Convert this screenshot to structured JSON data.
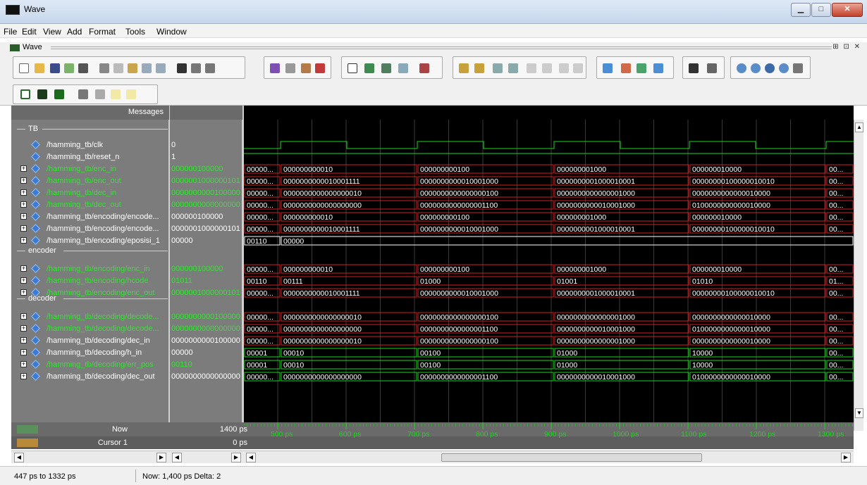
{
  "window": {
    "title": "Wave"
  },
  "menu": [
    "File",
    "Edit",
    "View",
    "Add",
    "Format",
    "Tools",
    "Window"
  ],
  "wave_header": {
    "label": "Wave"
  },
  "messages_header": "Messages",
  "groups": {
    "tb": "TB",
    "encoder": "encoder",
    "decoder": "decoder"
  },
  "signals": [
    {
      "name": "/hamming_tb/clk",
      "value": "0",
      "expandable": false,
      "highlight": false
    },
    {
      "name": "/hamming_tb/reset_n",
      "value": "1",
      "expandable": false,
      "highlight": false
    },
    {
      "name": "/hamming_tb/enc_in",
      "value": "000000100000",
      "expandable": true,
      "highlight": true
    },
    {
      "name": "/hamming_tb/enc_out",
      "value": "0000001000000101",
      "expandable": true,
      "highlight": true
    },
    {
      "name": "/hamming_tb/dec_in",
      "value": "0000000000100000",
      "expandable": true,
      "highlight": true
    },
    {
      "name": "/hamming_tb/dec_out",
      "value": "0000000000000000",
      "expandable": true,
      "highlight": true
    },
    {
      "name": "/hamming_tb/encoding/encode...",
      "value": "000000100000",
      "expandable": true,
      "highlight": false
    },
    {
      "name": "/hamming_tb/encoding/encode...",
      "value": "0000001000000101",
      "expandable": true,
      "highlight": false
    },
    {
      "name": "/hamming_tb/encoding/eposisi_1",
      "value": "00000",
      "expandable": true,
      "highlight": false
    },
    {
      "name": "/hamming_tb/encoding/enc_in",
      "value": "000000100000",
      "expandable": true,
      "highlight": true
    },
    {
      "name": "/hamming_tb/encoding/hcode",
      "value": "01011",
      "expandable": true,
      "highlight": true
    },
    {
      "name": "/hamming_tb/encoding/enc_out",
      "value": "0000001000000101",
      "expandable": true,
      "highlight": true
    },
    {
      "name": "/hamming_tb/decoding/decode...",
      "value": "0000000000100000",
      "expandable": true,
      "highlight": true
    },
    {
      "name": "/hamming_tb/decoding/decode...",
      "value": "0000000000000000",
      "expandable": true,
      "highlight": true
    },
    {
      "name": "/hamming_tb/decoding/dec_in",
      "value": "0000000000100000",
      "expandable": true,
      "highlight": false
    },
    {
      "name": "/hamming_tb/decoding/h_in",
      "value": "00000",
      "expandable": true,
      "highlight": false
    },
    {
      "name": "/hamming_tb/decoding/err_pos",
      "value": "00110",
      "expandable": true,
      "highlight": true
    },
    {
      "name": "/hamming_tb/decoding/dec_out",
      "value": "0000000000000000",
      "expandable": true,
      "highlight": false
    }
  ],
  "bus_values": [
    [
      "00000...",
      "000000000010",
      "000000000100",
      "000000001000",
      "000000010000",
      "00..."
    ],
    [
      "00000...",
      "0000000000010001111",
      "0000000000010001000",
      "0000000001000010001",
      "00000000100000010010",
      "00..."
    ],
    [
      "00000...",
      "0000000000000000010",
      "0000000000000000100",
      "0000000000000001000",
      "0000000000000010000",
      "00..."
    ],
    [
      "00000...",
      "0000000000000000000",
      "0000000000000001100",
      "0000000000010001000",
      "0100000000000010000",
      "00..."
    ],
    [
      "00000...",
      "000000000010",
      "000000000100",
      "000000001000",
      "000000010000",
      "00..."
    ],
    [
      "00000...",
      "0000000000010001111",
      "0000000000010001000",
      "0000000001000010001",
      "00000000100000010010",
      "00..."
    ],
    [
      "00110",
      "00000",
      "",
      "",
      "",
      ""
    ],
    [
      "00000...",
      "000000000010",
      "000000000100",
      "000000001000",
      "000000010000",
      "00..."
    ],
    [
      "00110",
      "00111",
      "01000",
      "01001",
      "01010",
      "01..."
    ],
    [
      "00000...",
      "0000000000010001111",
      "0000000000010001000",
      "0000000001000010001",
      "00000000100000010010",
      "00..."
    ],
    [
      "00000...",
      "0000000000000000010",
      "0000000000000000100",
      "0000000000000001000",
      "0000000000000010000",
      "00..."
    ],
    [
      "00000...",
      "0000000000000000000",
      "0000000000000001100",
      "0000000000010001000",
      "0100000000000010000",
      "00..."
    ],
    [
      "00000...",
      "0000000000000000010",
      "0000000000000000100",
      "0000000000000001000",
      "0000000000000010000",
      "00..."
    ],
    [
      "00001",
      "00010",
      "00100",
      "01000",
      "10000",
      "00..."
    ],
    [
      "00001",
      "00010",
      "00100",
      "01000",
      "10000",
      "00..."
    ],
    [
      "00000...",
      "0000000000000000000",
      "0000000000000001100",
      "0000000000010001000",
      "0100000000000010000",
      "00..."
    ]
  ],
  "timeline": {
    "now_label": "Now",
    "now_value": "1400 ps",
    "cursor_label": "Cursor 1",
    "cursor_value": "0 ps",
    "ticks": [
      "500 ps",
      "600 ps",
      "700 ps",
      "800 ps",
      "900 ps",
      "1000 ps",
      "1100 ps",
      "1200 ps",
      "1300 ps"
    ]
  },
  "status": {
    "range": "447 ps to 1332 ps",
    "now": "Now: 1,400 ps  Delta: 2"
  },
  "colors": {
    "wave_green": "#19d619",
    "bus_red": "#d21e1e",
    "grid": "#3a3a3a",
    "highlight_text": "#2ee62e"
  }
}
